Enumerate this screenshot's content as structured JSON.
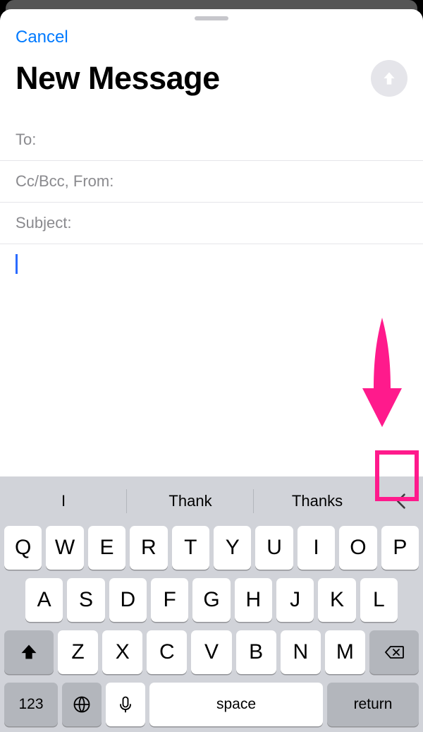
{
  "header": {
    "cancel_label": "Cancel",
    "title": "New Message"
  },
  "fields": {
    "to_label": "To:",
    "ccbcc_label": "Cc/Bcc, From:",
    "subject_label": "Subject:"
  },
  "suggestions": [
    "I",
    "Thank",
    "Thanks"
  ],
  "keyboard": {
    "row1": [
      "Q",
      "W",
      "E",
      "R",
      "T",
      "Y",
      "U",
      "I",
      "O",
      "P"
    ],
    "row2": [
      "A",
      "S",
      "D",
      "F",
      "G",
      "H",
      "J",
      "K",
      "L"
    ],
    "row3": [
      "Z",
      "X",
      "C",
      "V",
      "B",
      "N",
      "M"
    ],
    "numbers_key": "123",
    "space_label": "space",
    "return_label": "return"
  },
  "annotation_color": "#ff1a8c"
}
